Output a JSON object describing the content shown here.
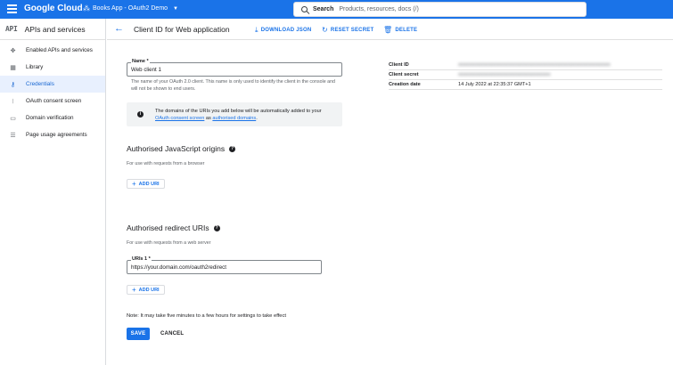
{
  "topbar": {
    "logo": "Google Cloud",
    "project": "Books App - OAuth2 Demo",
    "search_label": "Search",
    "search_placeholder": "Products, resources, docs (/)"
  },
  "sidebar": {
    "icon_text": "API",
    "title": "APIs and services",
    "items": [
      {
        "label": "Enabled APIs and services",
        "icon": "hub-icon"
      },
      {
        "label": "Library",
        "icon": "library-icon"
      },
      {
        "label": "Credentials",
        "icon": "key-icon",
        "active": true
      },
      {
        "label": "OAuth consent screen",
        "icon": "consent-icon"
      },
      {
        "label": "Domain verification",
        "icon": "domain-icon"
      },
      {
        "label": "Page usage agreements",
        "icon": "settings-list-icon"
      }
    ]
  },
  "header": {
    "title": "Client ID for Web application",
    "download": "DOWNLOAD JSON",
    "reset": "RESET SECRET",
    "delete": "DELETE"
  },
  "form": {
    "name_label": "Name *",
    "name_value": "Web client 1",
    "name_help": "The name of your OAuth 2.0 client. This name is only used to identify the client in the console and will not be shown to end users.",
    "info_text_1": "The domains of the URIs you add below will be automatically added to your ",
    "info_link_1": "OAuth consent screen",
    "info_text_2": " as ",
    "info_link_2": "authorised domains",
    "info_text_3": ".",
    "js_title": "Authorised JavaScript origins",
    "js_sub": "For use with requests from a browser",
    "add_uri": "ADD URI",
    "redirect_title": "Authorised redirect URIs",
    "redirect_sub": "For use with requests from a web server",
    "uri_label": "URIs 1 *",
    "uri_value": "https://your.domain.com/oauth2redirect",
    "note": "Note: It may take five minutes to a few hours for settings to take effect",
    "save": "SAVE",
    "cancel": "CANCEL"
  },
  "details": {
    "client_id_label": "Client ID",
    "client_id_value": "xxxxxxxxxxxxxxxxxxxxxxxxxxxxxxxxxxxxxxxxxxxxxxxxxxxxxxxxxxxxx",
    "client_secret_label": "Client secret",
    "client_secret_value": "xxxxxxxxxxxxxxxxxxxxxxxxxxxxxxxxxxxxx",
    "creation_date_label": "Creation date",
    "creation_date_value": "14 July 2022 at 22:35:37 GMT+1"
  },
  "colors": {
    "accent": "#1a73e8",
    "active_bg": "#e8f0fe"
  }
}
